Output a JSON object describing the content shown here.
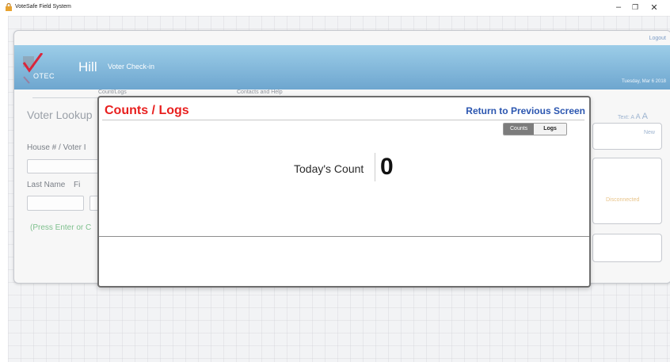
{
  "window": {
    "title": "VoteSafe Field System",
    "minimize": "–",
    "maximize": "❐",
    "close": "✕"
  },
  "app": {
    "logout": "Logout",
    "logo_text": "OTEC",
    "precinct": "Hill",
    "subtitle": "Voter Check-in",
    "date": "Tuesday, Mar 6 2018",
    "tabs": [
      {
        "label": "Count/Logs"
      },
      {
        "label": "Contacts and Help"
      }
    ],
    "lookup": {
      "title": "Voter Lookup",
      "house_label": "House # / Voter I",
      "last_name_label": "Last Name",
      "first_name_label": "Fi",
      "press_hint": "(Press Enter or C"
    },
    "text_size": {
      "label": "Text:",
      "a_small": "A",
      "a_medium": "A",
      "a_large": "A"
    },
    "new_label": "New",
    "status": "Disconnected"
  },
  "modal": {
    "title": "Counts / Logs",
    "return_link": "Return to Previous Screen",
    "toggle": {
      "counts": "Counts",
      "logs": "Logs",
      "selected": "Counts"
    },
    "count_label": "Today's Count",
    "count_value": "0"
  },
  "colors": {
    "modal_title": "#e8201f",
    "link": "#2b56b0",
    "banner": "#6ea6cf",
    "press_hint": "#7ec08d",
    "disconnected": "#e8c48a"
  }
}
